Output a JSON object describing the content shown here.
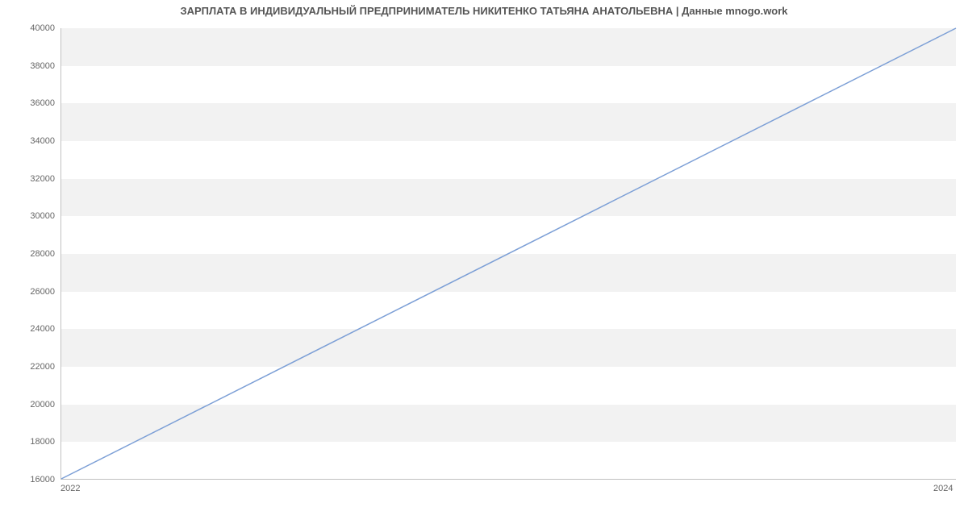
{
  "chart_data": {
    "type": "line",
    "title": "ЗАРПЛАТА В ИНДИВИДУАЛЬНЫЙ ПРЕДПРИНИМАТЕЛЬ НИКИТЕНКО ТАТЬЯНА АНАТОЛЬЕВНА | Данные mnogo.work",
    "x": [
      2022,
      2024
    ],
    "values": [
      16000,
      40000
    ],
    "series_name": "Зарплата",
    "xlabel": "",
    "ylabel": "",
    "x_ticks": [
      2022,
      2024
    ],
    "y_ticks": [
      16000,
      18000,
      20000,
      22000,
      24000,
      26000,
      28000,
      30000,
      32000,
      34000,
      36000,
      38000,
      40000
    ],
    "xlim": [
      2022,
      2024
    ],
    "ylim": [
      16000,
      40000
    ],
    "line_color": "#7c9fd6",
    "band_color": "#f2f2f2"
  }
}
